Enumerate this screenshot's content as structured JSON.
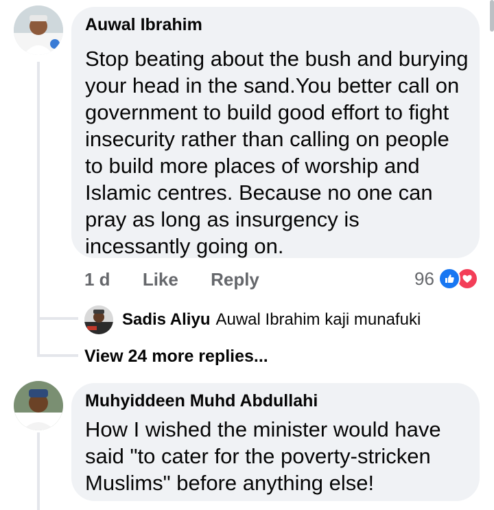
{
  "comments": [
    {
      "author": "Auwal Ibrahim",
      "text": "Stop beating about the bush and burying your head in the sand.You better call on government to build good effort to fight insecurity rather than calling on people to build more places of worship and Islamic centres. Because no one can pray as long as insurgency is incessantly going on.",
      "time": "1 d",
      "like_label": "Like",
      "reply_label": "Reply",
      "reaction_count": "96",
      "reactions": [
        "like-icon",
        "love-icon"
      ]
    },
    {
      "author": "Muhyiddeen Muhd Abdullahi",
      "text": "How I wished the minister would have said \"to cater for the poverty-stricken Muslims\" before anything else!"
    }
  ],
  "reply": {
    "author": "Sadis Aliyu",
    "text": "Auwal Ibrahim kaji munafuki"
  },
  "view_more_label": "View 24 more replies...",
  "colors": {
    "bubble": "#f0f2f5",
    "secondary_text": "#65676b",
    "like_blue": "#1877f2",
    "love_red": "#f33e58"
  }
}
